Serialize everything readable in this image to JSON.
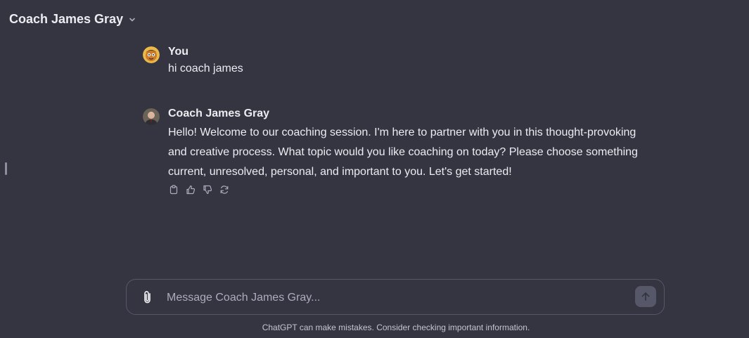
{
  "header": {
    "title": "Coach James Gray",
    "dropdown_icon": "chevron-down-icon"
  },
  "messages": [
    {
      "author": "You",
      "text": "hi coach james",
      "avatar": "user-avatar"
    },
    {
      "author": "Coach James Gray",
      "text": "Hello! Welcome to our coaching session. I'm here to partner with you in this thought-provoking and creative process. What topic would you like coaching on today? Please choose something current, unresolved, personal, and important to you. Let's get started!",
      "avatar": "coach-avatar",
      "actions": [
        "copy-icon",
        "thumbs-up-icon",
        "thumbs-down-icon",
        "regenerate-icon"
      ]
    }
  ],
  "composer": {
    "placeholder": "Message Coach James Gray...",
    "value": "",
    "attach_icon": "paperclip-icon",
    "send_icon": "arrow-up-icon"
  },
  "footer": {
    "note": "ChatGPT can make mistakes. Consider checking important information."
  },
  "colors": {
    "background": "#343541",
    "text": "#ececf1",
    "muted": "#acacbe",
    "border": "#565869"
  }
}
